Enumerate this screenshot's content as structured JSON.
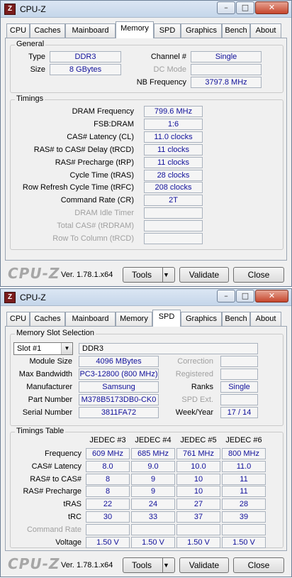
{
  "window1": {
    "title": "CPU-Z",
    "app_icon_letter": "Z",
    "tabs": [
      "CPU",
      "Caches",
      "Mainboard",
      "Memory",
      "SPD",
      "Graphics",
      "Bench",
      "About"
    ],
    "active_tab": "Memory",
    "general": {
      "group_label": "General",
      "type_label": "Type",
      "type_value": "DDR3",
      "size_label": "Size",
      "size_value": "8 GBytes",
      "channel_label": "Channel #",
      "channel_value": "Single",
      "dc_mode_label": "DC Mode",
      "dc_mode_value": "",
      "nb_freq_label": "NB Frequency",
      "nb_freq_value": "3797.8 MHz"
    },
    "timings": {
      "group_label": "Timings",
      "rows": [
        {
          "label": "DRAM Frequency",
          "value": "799.6 MHz",
          "disabled": false
        },
        {
          "label": "FSB:DRAM",
          "value": "1:6",
          "disabled": false
        },
        {
          "label": "CAS# Latency (CL)",
          "value": "11.0 clocks",
          "disabled": false
        },
        {
          "label": "RAS# to CAS# Delay (tRCD)",
          "value": "11 clocks",
          "disabled": false
        },
        {
          "label": "RAS# Precharge (tRP)",
          "value": "11 clocks",
          "disabled": false
        },
        {
          "label": "Cycle Time (tRAS)",
          "value": "28 clocks",
          "disabled": false
        },
        {
          "label": "Row Refresh Cycle Time (tRFC)",
          "value": "208 clocks",
          "disabled": false
        },
        {
          "label": "Command Rate (CR)",
          "value": "2T",
          "disabled": false
        },
        {
          "label": "DRAM Idle Timer",
          "value": "",
          "disabled": true
        },
        {
          "label": "Total CAS# (tRDRAM)",
          "value": "",
          "disabled": true
        },
        {
          "label": "Row To Column (tRCD)",
          "value": "",
          "disabled": true
        }
      ]
    },
    "footer": {
      "logo": "CPU-Z",
      "version": "Ver. 1.78.1.x64",
      "tools_label": "Tools",
      "validate_label": "Validate",
      "close_label": "Close"
    }
  },
  "window2": {
    "title": "CPU-Z",
    "app_icon_letter": "Z",
    "tabs": [
      "CPU",
      "Caches",
      "Mainboard",
      "Memory",
      "SPD",
      "Graphics",
      "Bench",
      "About"
    ],
    "active_tab": "SPD",
    "slot": {
      "group_label": "Memory Slot Selection",
      "slot_select": "Slot #1",
      "slot_type": "DDR3",
      "module_size_label": "Module Size",
      "module_size_value": "4096 MBytes",
      "max_bw_label": "Max Bandwidth",
      "max_bw_value": "PC3-12800 (800 MHz)",
      "manufacturer_label": "Manufacturer",
      "manufacturer_value": "Samsung",
      "part_label": "Part Number",
      "part_value": "M378B5173DB0-CK0",
      "serial_label": "Serial Number",
      "serial_value": "3811FA72",
      "correction_label": "Correction",
      "correction_value": "",
      "registered_label": "Registered",
      "registered_value": "",
      "ranks_label": "Ranks",
      "ranks_value": "Single",
      "spd_ext_label": "SPD Ext.",
      "spd_ext_value": "",
      "week_year_label": "Week/Year",
      "week_year_value": "17 / 14"
    },
    "timings_table": {
      "group_label": "Timings Table",
      "columns": [
        "JEDEC #3",
        "JEDEC #4",
        "JEDEC #5",
        "JEDEC #6"
      ],
      "rows": [
        {
          "label": "Frequency",
          "disabled": false,
          "values": [
            "609 MHz",
            "685 MHz",
            "761 MHz",
            "800 MHz"
          ]
        },
        {
          "label": "CAS# Latency",
          "disabled": false,
          "values": [
            "8.0",
            "9.0",
            "10.0",
            "11.0"
          ]
        },
        {
          "label": "RAS# to CAS#",
          "disabled": false,
          "values": [
            "8",
            "9",
            "10",
            "11"
          ]
        },
        {
          "label": "RAS# Precharge",
          "disabled": false,
          "values": [
            "8",
            "9",
            "10",
            "11"
          ]
        },
        {
          "label": "tRAS",
          "disabled": false,
          "values": [
            "22",
            "24",
            "27",
            "28"
          ]
        },
        {
          "label": "tRC",
          "disabled": false,
          "values": [
            "30",
            "33",
            "37",
            "39"
          ]
        },
        {
          "label": "Command Rate",
          "disabled": true,
          "values": [
            "",
            "",
            "",
            ""
          ]
        },
        {
          "label": "Voltage",
          "disabled": false,
          "values": [
            "1.50 V",
            "1.50 V",
            "1.50 V",
            "1.50 V"
          ]
        }
      ]
    },
    "footer": {
      "logo": "CPU-Z",
      "version": "Ver. 1.78.1.x64",
      "tools_label": "Tools",
      "validate_label": "Validate",
      "close_label": "Close"
    }
  }
}
